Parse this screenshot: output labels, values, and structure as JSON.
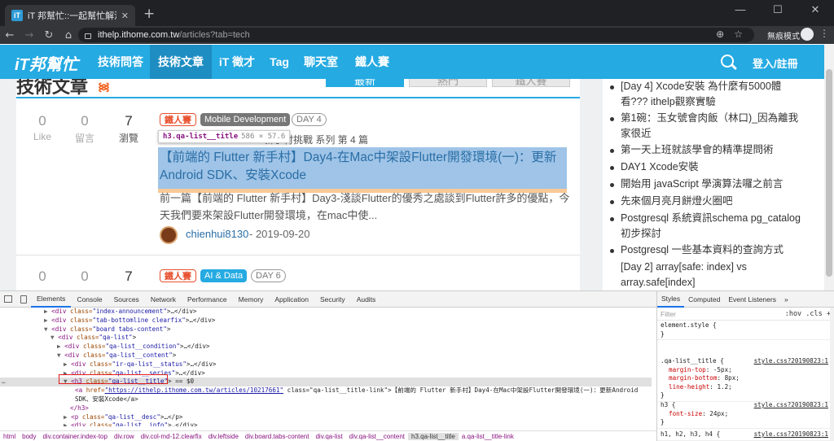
{
  "browser": {
    "tab_title": "iT 邦幫忙::一起幫忙解決難題，拯",
    "tab_favicon": "iT",
    "url_host": "ithelp.ithome.com.tw",
    "url_path": "/articles?tab=tech",
    "incognito_label": "無痕模式"
  },
  "site": {
    "logo": "iT邦幫忙",
    "nav": [
      "技術問答",
      "技術文章",
      "iT 徵才",
      "Tag",
      "聊天室",
      "鐵人賽"
    ],
    "login": "登入/註冊",
    "brand_color": "#25aae2"
  },
  "main": {
    "section_title": "技術文章",
    "content_tabs": [
      "最新",
      "熱門",
      "鐵人賽"
    ],
    "articles": [
      {
        "like": "0",
        "like_label": "Like",
        "reply": "0",
        "reply_label": "留言",
        "views": "7",
        "views_label": "瀏覽",
        "tags": [
          "鐵人賽",
          "Mobile Development",
          "DAY 4"
        ],
        "series_text": "新手村挑戰 系列 第 4 篇",
        "title": "【前端的 Flutter 新手村】Day4-在Mac中架設Flutter開發環境(一)：更新Android SDK、安裝Xcode",
        "desc": "前一篇【前端的 Flutter 新手村】Day3-淺談Flutter的優秀之處談到Flutter許多的優點，今天我們要來架設Flutter開發環境，在mac中使...",
        "author": "chienhui8130",
        "date": "- 2019-09-20"
      },
      {
        "like": "0",
        "reply": "0",
        "views": "7",
        "tags": [
          "鐵人賽",
          "AI & Data",
          "DAY 6"
        ]
      }
    ]
  },
  "tooltip": {
    "name": "h3.qa-list__title",
    "size": "586 × 57.6"
  },
  "sidebar": {
    "items": [
      "[Day 4] Xcode安裝 為什麼有5000體看??? ithelp觀察實驗",
      "第1碗：玉女號會肉飯（林口)_因為離我家很近",
      "第一天上班就該學會的精準提問術",
      "DAY1 Xcode安裝",
      "開始用 javaScript 學演算法囉之前言",
      "先來個月亮月餅燈火圈吧",
      "Postgresql 系統資訊schema pg_catalog 初步探討",
      "Postgresql 一些基本資料的查詢方式",
      "[Day 2] array[safe: index] vs array.safe[index]"
    ]
  },
  "devtools": {
    "tabs": [
      "Elements",
      "Console",
      "Sources",
      "Network",
      "Performance",
      "Memory",
      "Application",
      "Security",
      "Audits"
    ],
    "dom_lines": [
      {
        "tri": "▶",
        "open": "<div",
        "attr": " class=",
        "val": "\"index-announcement\"",
        "tail": ">…</div>"
      },
      {
        "tri": "▶",
        "open": "<div",
        "attr": " class=",
        "val": "\"tab-bottomline clearfix\"",
        "tail": ">…</div>"
      },
      {
        "tri": "▼",
        "open": "<div",
        "attr": " class=",
        "val": "\"board tabs-content\"",
        "tail": ">"
      },
      {
        "tri": "▼",
        "open": "<div",
        "attr": " class=",
        "val": "\"qa-list\"",
        "tail": ">"
      },
      {
        "tri": "▶",
        "open": "<div",
        "attr": " class=",
        "val": "\"qa-list__condition\"",
        "tail": ">…</div>"
      },
      {
        "tri": "▼",
        "open": "<div",
        "attr": " class=",
        "val": "\"qa-list__content\"",
        "tail": ">"
      },
      {
        "tri": "▶",
        "open": "<div",
        "attr": " class=",
        "val": "\"ir-qa-list__status\"",
        "tail": ">…</div>"
      },
      {
        "tri": "▶",
        "open": "<div",
        "attr": " class=",
        "val": "\"qa-list__series\"",
        "tail": ">…</div>"
      },
      {
        "tri": "▼",
        "open": "<h3",
        "attr": " class=",
        "val": "\"qa-list__title\"",
        "tail": "> == $0"
      },
      {
        "tri": "",
        "open": "<a",
        "attr": " href=",
        "val": "\"https://ithelp.ithome.com.tw/articles/10217661\"",
        "tail": " class=\"qa-list__title-link\">【前端的 Flutter 新手村】Day4-在Mac中架設Flutter開發環境(一)：更新Android"
      },
      {
        "tri": "",
        "open": "",
        "attr": "",
        "val": "",
        "tail": "SDK、安裝Xcode</a>"
      },
      {
        "tri": "",
        "open": "</h3>",
        "attr": "",
        "val": "",
        "tail": ""
      },
      {
        "tri": "▶",
        "open": "<p",
        "attr": " class=",
        "val": "\"qa-list__desc\"",
        "tail": ">…</p>"
      },
      {
        "tri": "▶",
        "open": "<div",
        "attr": " class=",
        "val": "\"qa-list__info\"",
        "tail": ">…</div>"
      }
    ],
    "breadcrumbs": [
      "html",
      "body",
      "div.container.index-top",
      "div.row",
      "div.col-md-12.clearfix",
      "div.leftside",
      "div.board.tabs-content",
      "div.qa-list",
      "div.qa-list__content",
      "h3.qa-list__title",
      "a.qa-list__title-link"
    ],
    "styles_tabs": [
      "Styles",
      "Computed",
      "Event Listeners",
      "»"
    ],
    "filter_placeholder": "Filter",
    "filter_opts": ":hov .cls +",
    "rules": [
      {
        "selector": "element.style {",
        "src": "",
        "props": [],
        "close": "}"
      },
      {
        "selector": ".qa-list__title {",
        "src": "style.css?20190823:1",
        "props": [
          [
            "margin-top",
            "-5px;"
          ],
          [
            "margin-bottom",
            "8px;"
          ],
          [
            "line-height",
            "1.2;"
          ]
        ],
        "close": "}"
      },
      {
        "selector": "h3 {",
        "src": "style.css?20190823:1",
        "props": [
          [
            "font-size",
            "24px;"
          ]
        ],
        "close": "}"
      },
      {
        "selector": "h1, h2, h3, h4 {",
        "src": "style.css?20190823:1",
        "props": [],
        "close": ""
      }
    ]
  }
}
